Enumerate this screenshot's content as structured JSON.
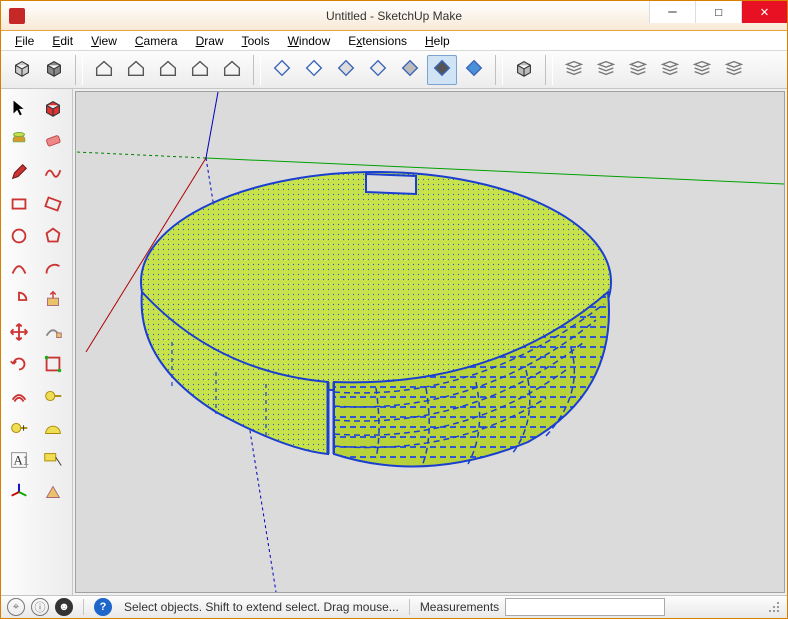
{
  "window": {
    "title": "Untitled - SketchUp Make"
  },
  "menu": {
    "file": "File",
    "edit": "Edit",
    "view": "View",
    "camera": "Camera",
    "draw": "Draw",
    "tools": "Tools",
    "window": "Window",
    "extensions": "Extensions",
    "help": "Help"
  },
  "status": {
    "hint": "Select objects. Shift to extend select. Drag mouse...",
    "measurements_label": "Measurements",
    "measurements_value": ""
  },
  "toolbar_top": {
    "groups": [
      [
        "make-component",
        "component-browser"
      ],
      [
        "model-home",
        "model-nav-1",
        "model-nav-2",
        "model-nav-3",
        "model-nav-4"
      ],
      [
        "style-wire",
        "style-hidden",
        "style-shaded",
        "style-shaded-tex",
        "style-mono",
        "style-xray",
        "style-back"
      ],
      [
        "scene-thumb"
      ],
      [
        "layer-1",
        "layer-2",
        "layer-3",
        "layer-4",
        "layer-5",
        "layer-6"
      ]
    ],
    "pressed": "style-xray"
  },
  "toolbar_left": [
    [
      "select-tool",
      "component-tool"
    ],
    [
      "paint-tool",
      "eraser-tool"
    ],
    [
      "line-tool",
      "freehand-tool"
    ],
    [
      "rectangle-tool",
      "rotated-rect-tool"
    ],
    [
      "circle-tool",
      "polygon-tool"
    ],
    [
      "arc-tool",
      "arc2-tool"
    ],
    [
      "pie-tool",
      "pushpull-tool"
    ],
    [
      "move-tool",
      "followme-tool"
    ],
    [
      "rotate-tool",
      "scale-tool"
    ],
    [
      "offset-tool",
      "tape-tool"
    ],
    [
      "dimension-tool",
      "protractor-tool"
    ],
    [
      "text-tool",
      "label-tool"
    ],
    [
      "axes-tool",
      "section-tool"
    ]
  ],
  "icons": {
    "select-tool": "cursor",
    "component-tool": "cube-red",
    "paint-tool": "bucket",
    "eraser-tool": "eraser",
    "line-tool": "pencil",
    "freehand-tool": "squiggle",
    "rectangle-tool": "rect",
    "rotated-rect-tool": "rot-rect",
    "circle-tool": "circle",
    "polygon-tool": "poly",
    "arc-tool": "arc",
    "arc2-tool": "arc2",
    "pie-tool": "pie",
    "pushpull-tool": "pushpull",
    "move-tool": "move",
    "followme-tool": "followme",
    "rotate-tool": "rotate",
    "scale-tool": "scale",
    "offset-tool": "offset",
    "tape-tool": "tape",
    "dimension-tool": "tape2",
    "protractor-tool": "protractor",
    "text-tool": "text",
    "label-tool": "label",
    "axes-tool": "axes",
    "section-tool": "section"
  }
}
